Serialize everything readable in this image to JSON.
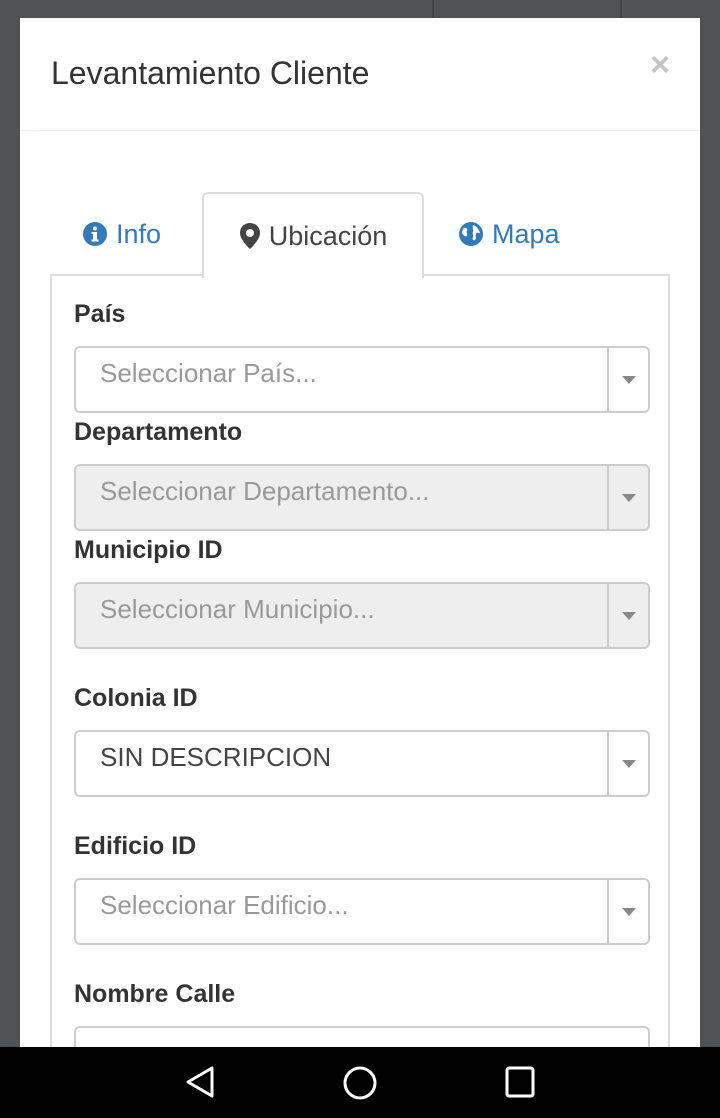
{
  "modal": {
    "title": "Levantamiento Cliente",
    "close_label": "×"
  },
  "tabs": [
    {
      "label": "Info",
      "icon": "info-icon",
      "active": false
    },
    {
      "label": "Ubicación",
      "icon": "map-marker-icon",
      "active": true
    },
    {
      "label": "Mapa",
      "icon": "globe-icon",
      "active": false
    }
  ],
  "fields": {
    "pais": {
      "label": "País",
      "placeholder": "Seleccionar País...",
      "disabled": false
    },
    "departamento": {
      "label": "Departamento",
      "placeholder": "Seleccionar Departamento...",
      "disabled": true
    },
    "municipio": {
      "label": "Municipio ID",
      "placeholder": "Seleccionar Municipio...",
      "disabled": true
    },
    "colonia": {
      "label": "Colonia ID",
      "value": "SIN DESCRIPCION",
      "disabled": false
    },
    "edificio": {
      "label": "Edificio ID",
      "placeholder": "Seleccionar Edificio...",
      "disabled": false
    },
    "calle": {
      "label": "Nombre Calle",
      "value": ""
    }
  },
  "colors": {
    "link_blue": "#337ab7",
    "disabled_bg": "#eeeeee",
    "backdrop": "#4f5153"
  }
}
